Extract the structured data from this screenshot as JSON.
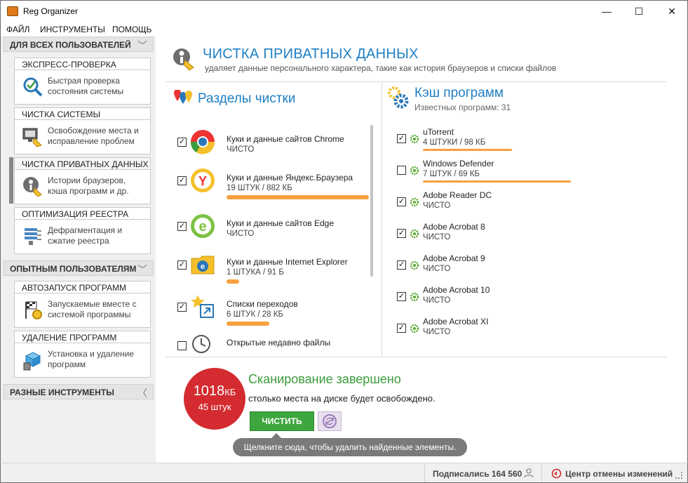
{
  "window": {
    "title": "Reg Organizer",
    "minimize": "—",
    "maximize": "☐",
    "close": "✕"
  },
  "menu": [
    "ФАЙЛ",
    "ИНСТРУМЕНТЫ",
    "ПОМОЩЬ"
  ],
  "sidebar": {
    "sections": [
      {
        "label": "ДЛЯ ВСЕХ ПОЛЬЗОВАТЕЛЕЙ",
        "chevron": "﹀"
      },
      {
        "label": "ОПЫТНЫМ ПОЛЬЗОВАТЕЛЯМ",
        "chevron": "﹀"
      },
      {
        "label": "РАЗНЫЕ ИНСТРУМЕНТЫ",
        "chevron": "〈"
      }
    ],
    "tools": [
      {
        "title": "ЭКСПРЕСС-ПРОВЕРКА",
        "desc1": "Быстрая проверка",
        "desc2": "состояния системы",
        "icon": "magnifier-check-icon"
      },
      {
        "title": "ЧИСТКА СИСТЕМЫ",
        "desc1": "Освобождение места и",
        "desc2": "исправление проблем",
        "icon": "computer-broom-icon"
      },
      {
        "title": "ЧИСТКА ПРИВАТНЫХ ДАННЫХ",
        "desc1": "Истории браузеров,",
        "desc2": "кэша программ и др.",
        "icon": "privacy-broom-icon"
      },
      {
        "title": "ОПТИМИЗАЦИЯ РЕЕСТРА",
        "desc1": "Дефрагментация и",
        "desc2": "сжатие реестра",
        "icon": "registry-icon"
      },
      {
        "title": "АВТОЗАПУСК ПРОГРАММ",
        "desc1": "Запускаемые вместе с",
        "desc2": "системой программы",
        "icon": "flag-gear-icon"
      },
      {
        "title": "УДАЛЕНИЕ ПРОГРАММ",
        "desc1": "Установка и удаление",
        "desc2": "программ",
        "icon": "box-trash-icon"
      }
    ]
  },
  "header": {
    "title": "ЧИСТКА ПРИВАТНЫХ ДАННЫХ",
    "subtitle": "удаляет данные персонального характера, такие как история браузеров и списки файлов"
  },
  "sections_pane": {
    "title": "Разделы чистки",
    "items": [
      {
        "name": "Куки и данные сайтов Chrome",
        "status": "ЧИСТО",
        "checked": true,
        "icon": "chrome-icon",
        "bar": 0
      },
      {
        "name": "Куки и данные Яндекс.Браузера",
        "status": "19 ШТУК / 882 КБ",
        "checked": true,
        "icon": "yandex-browser-icon",
        "bar": 1
      },
      {
        "name": "Куки и данные сайтов Edge",
        "status": "ЧИСТО",
        "checked": true,
        "icon": "edge-icon",
        "bar": 0
      },
      {
        "name": "Куки и данные Internet Explorer",
        "status": "1 ШТУКА / 91 Б",
        "checked": true,
        "icon": "internet-explorer-icon",
        "bar": 0.09
      },
      {
        "name": "Списки переходов",
        "status": "6 ШТУК / 28 КБ",
        "checked": true,
        "icon": "jump-list-icon",
        "bar": 0.3
      },
      {
        "name": "Открытые недавно файлы",
        "status": "",
        "checked": false,
        "icon": "recent-files-icon",
        "bar": 0
      }
    ]
  },
  "cache_pane": {
    "title": "Кэш программ",
    "subtitle": "Известных программ: 31",
    "items": [
      {
        "name": "uTorrent",
        "status": "4 ШТУКИ / 98 КБ",
        "checked": true,
        "bar": 0.6
      },
      {
        "name": "Windows Defender",
        "status": "7 ШТУК / 69 КБ",
        "checked": false,
        "bar": 1
      },
      {
        "name": "Adobe Reader DC",
        "status": "ЧИСТО",
        "checked": true,
        "bar": 0
      },
      {
        "name": "Adobe Acrobat 8",
        "status": "ЧИСТО",
        "checked": true,
        "bar": 0
      },
      {
        "name": "Adobe Acrobat 9",
        "status": "ЧИСТО",
        "checked": true,
        "bar": 0
      },
      {
        "name": "Adobe Acrobat 10",
        "status": "ЧИСТО",
        "checked": true,
        "bar": 0
      },
      {
        "name": "Adobe Acrobat XI",
        "status": "ЧИСТО",
        "checked": true,
        "bar": 0
      }
    ]
  },
  "result": {
    "size_value": "1018",
    "size_unit": "КБ",
    "count": "45 штук",
    "title": "Сканирование завершено",
    "subtitle": "столько места на диске будет освобождено.",
    "clean_button": "ЧИСТИТЬ",
    "tooltip": "Щелкните сюда, чтобы удалить найденные элементы."
  },
  "status": {
    "subscribers": "Подписались 164 560",
    "undo_center": "Центр отмены изменений"
  },
  "colors": {
    "accent_blue": "#1e7fc3",
    "green": "#3ea63e",
    "orange": "#f7a040",
    "red": "#d32b2f"
  }
}
